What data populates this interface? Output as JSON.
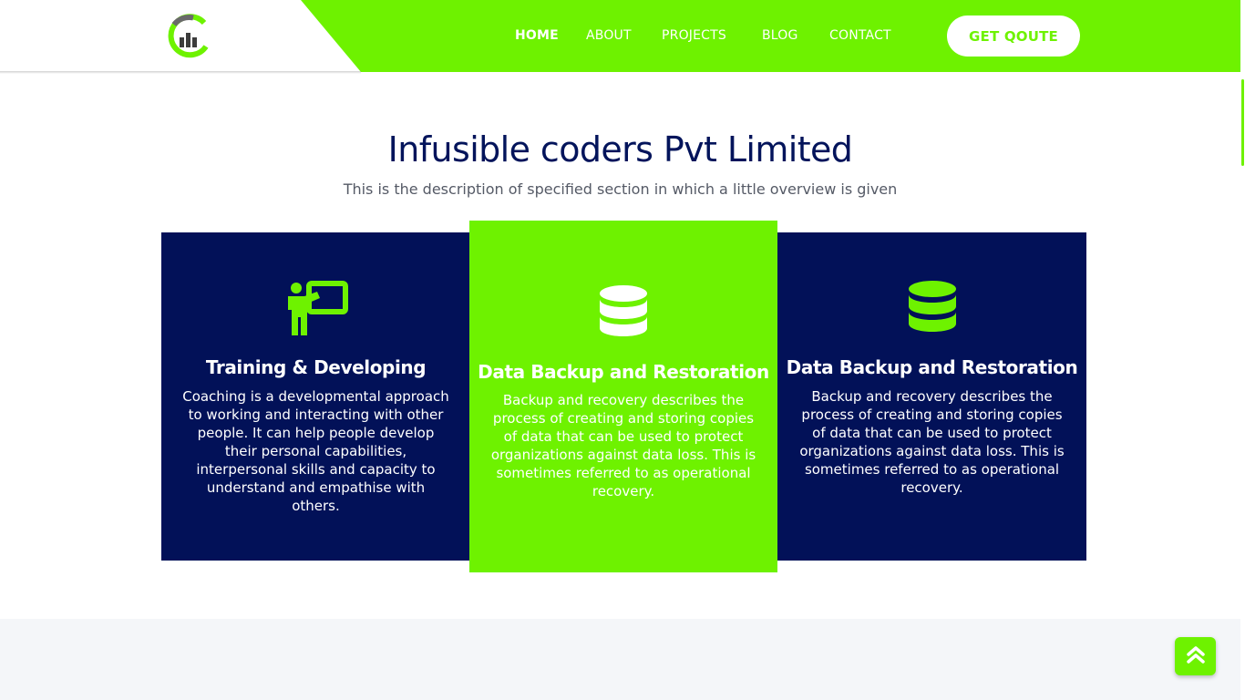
{
  "brand": {
    "logo_icon": "chart-c-logo-icon",
    "accent_color": "#6ef200",
    "navy_color": "#021158"
  },
  "nav": {
    "items": [
      {
        "label": "HOME",
        "active": true
      },
      {
        "label": "ABOUT",
        "active": false
      },
      {
        "label": "PROJECTS",
        "active": false
      },
      {
        "label": "BLOG",
        "active": false
      },
      {
        "label": "CONTACT",
        "active": false
      }
    ],
    "cta_label": "GET QOUTE"
  },
  "section": {
    "title": "Infusible coders Pvt Limited",
    "description": "This is the description of specified section in which a little overview is given"
  },
  "cards": [
    {
      "icon": "teacher-board-icon",
      "title": "Training & Developing",
      "text": "Coaching is a developmental approach to working and interacting with other people. It can help people develop their personal capabilities, interpersonal skills and capacity to understand and empathise with others."
    },
    {
      "icon": "database-icon",
      "title": "Data Backup and Restoration",
      "text": "Backup and recovery describes the process of creating and storing copies of data that can be used to protect organizations against data loss. This is sometimes referred to as operational recovery."
    },
    {
      "icon": "database-icon",
      "title": "Data Backup and Restoration",
      "text": "Backup and recovery describes the process of creating and storing copies of data that can be used to protect organizations against data loss. This is sometimes referred to as operational recovery."
    }
  ],
  "scroll_top": {
    "icon": "double-chevron-up-icon"
  }
}
